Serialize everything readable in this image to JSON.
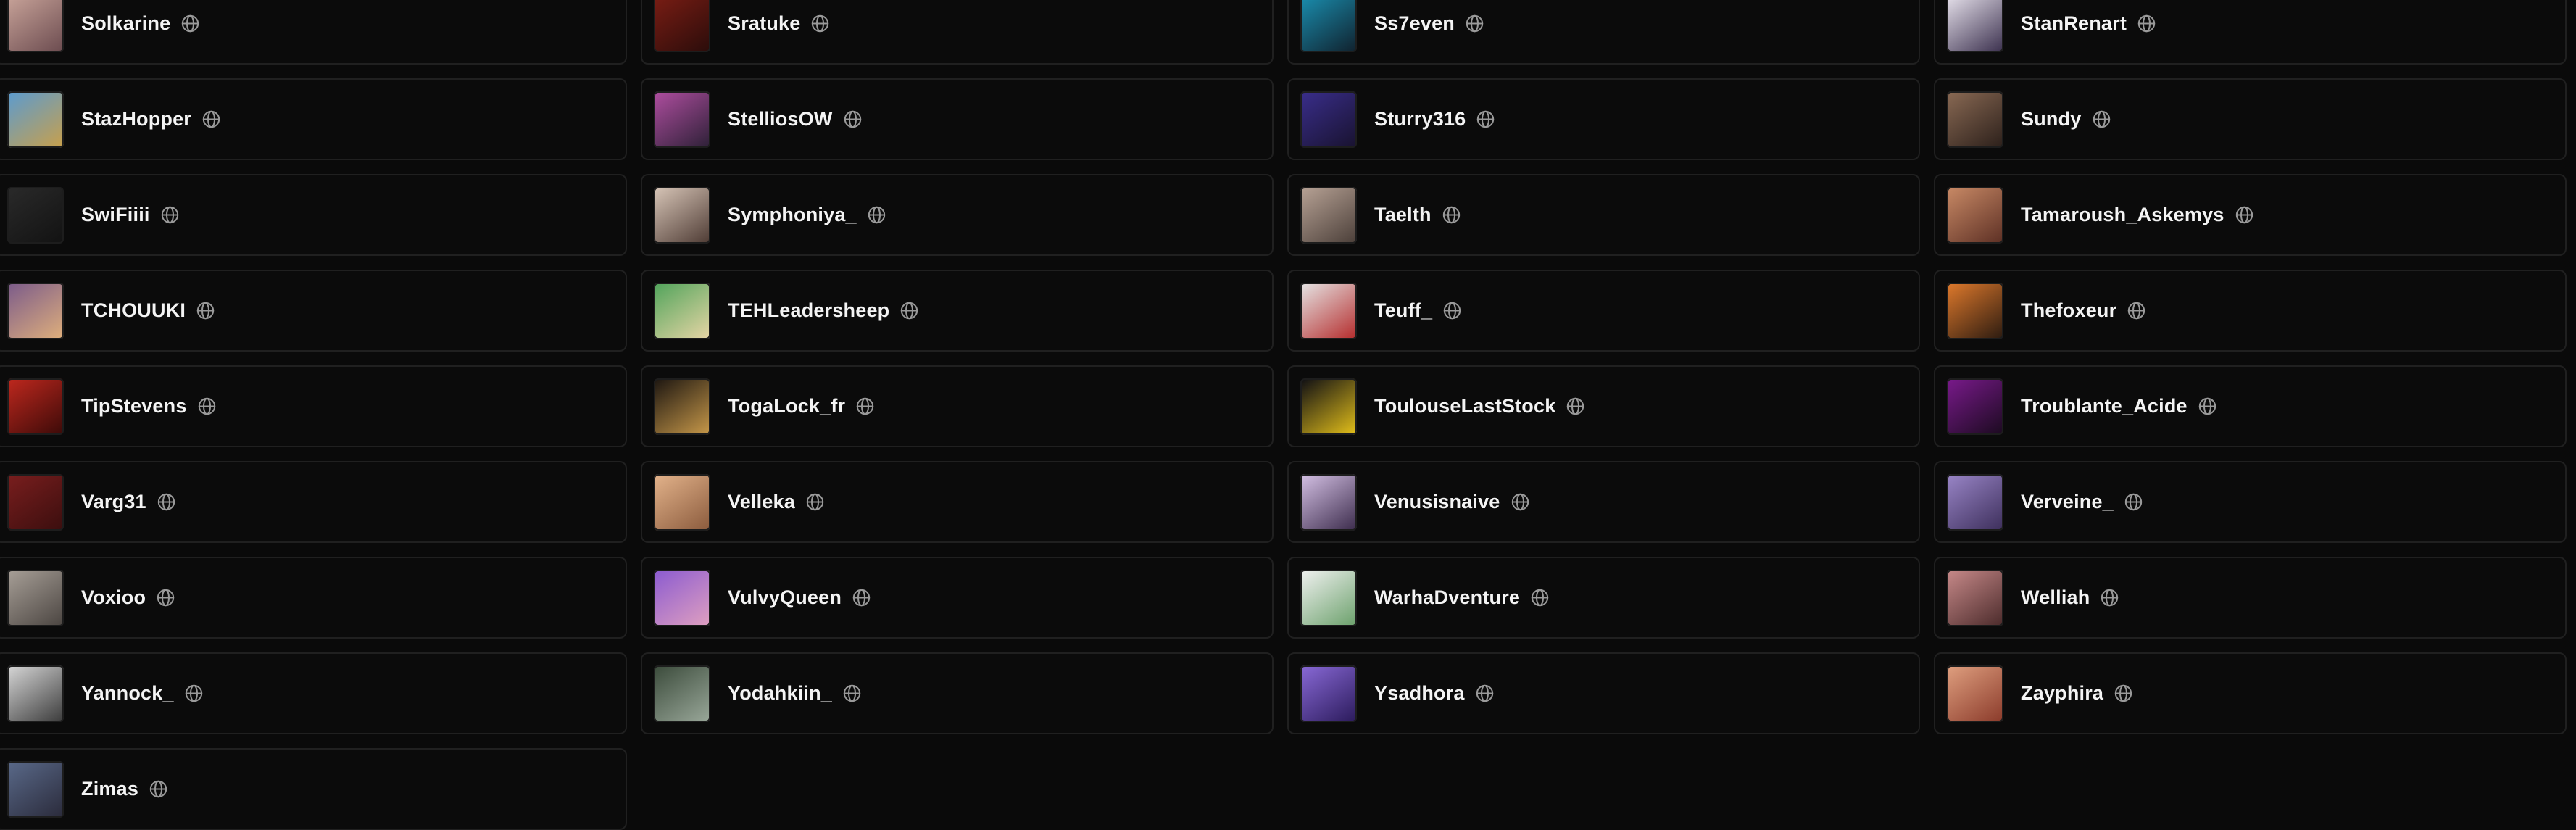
{
  "streamers": [
    {
      "name": "Solkarine",
      "avatar_colors": [
        "#c9a49a",
        "#6b4b4f"
      ]
    },
    {
      "name": "Sratuke",
      "avatar_colors": [
        "#7a1d14",
        "#2a0c0a"
      ]
    },
    {
      "name": "Ss7even",
      "avatar_colors": [
        "#1a8fb0",
        "#10202c"
      ]
    },
    {
      "name": "StanRenart",
      "avatar_colors": [
        "#e7e2ec",
        "#3a2f4d"
      ]
    },
    {
      "name": "StazHopper",
      "avatar_colors": [
        "#5a9bd1",
        "#c9a04a"
      ]
    },
    {
      "name": "StelliosOW",
      "avatar_colors": [
        "#b04ea0",
        "#2c2036"
      ]
    },
    {
      "name": "Sturry316",
      "avatar_colors": [
        "#3a2e8c",
        "#18122e"
      ]
    },
    {
      "name": "Sundy",
      "avatar_colors": [
        "#8a6a54",
        "#2b1f1a"
      ]
    },
    {
      "name": "SwiFiiii",
      "avatar_colors": [
        "#2a2a2a",
        "#121212"
      ]
    },
    {
      "name": "Symphoniya_",
      "avatar_colors": [
        "#d8c6b8",
        "#4d3a33"
      ]
    },
    {
      "name": "Taelth",
      "avatar_colors": [
        "#b8a396",
        "#4a3e38"
      ]
    },
    {
      "name": "Tamaroush_Askemys",
      "avatar_colors": [
        "#c98a66",
        "#5c2f24"
      ]
    },
    {
      "name": "TCHOUUKI",
      "avatar_colors": [
        "#7a5a8a",
        "#e0b07c"
      ]
    },
    {
      "name": "TEHLeadersheep",
      "avatar_colors": [
        "#4fa35a",
        "#e8d6a6"
      ]
    },
    {
      "name": "Teuff_",
      "avatar_colors": [
        "#e6e6e6",
        "#b42a2a"
      ]
    },
    {
      "name": "Thefoxeur",
      "avatar_colors": [
        "#e07a2c",
        "#2a1a10"
      ]
    },
    {
      "name": "TipStevens",
      "avatar_colors": [
        "#c0281e",
        "#3a0a08"
      ]
    },
    {
      "name": "TogaLock_fr",
      "avatar_colors": [
        "#1a1410",
        "#c99a4a"
      ]
    },
    {
      "name": "ToulouseLastStock",
      "avatar_colors": [
        "#0c0c14",
        "#e6c21a"
      ]
    },
    {
      "name": "Troublante_Acide",
      "avatar_colors": [
        "#7a1a8c",
        "#1a0a1e"
      ]
    },
    {
      "name": "Varg31",
      "avatar_colors": [
        "#7a1e1e",
        "#3a0e0e"
      ]
    },
    {
      "name": "Velleka",
      "avatar_colors": [
        "#e4b48c",
        "#8a5a3c"
      ]
    },
    {
      "name": "Venusisnaive",
      "avatar_colors": [
        "#d6c2e6",
        "#3a2a4a"
      ]
    },
    {
      "name": "Verveine_",
      "avatar_colors": [
        "#9a86c8",
        "#3c2e5a"
      ]
    },
    {
      "name": "Voxioo",
      "avatar_colors": [
        "#a8a098",
        "#4a4440"
      ]
    },
    {
      "name": "VulvyQueen",
      "avatar_colors": [
        "#8a5ad0",
        "#e0a0c0"
      ]
    },
    {
      "name": "WarhaDventure",
      "avatar_colors": [
        "#f2f2f2",
        "#6aa06a"
      ]
    },
    {
      "name": "Welliah",
      "avatar_colors": [
        "#c88a8a",
        "#4a2a2a"
      ]
    },
    {
      "name": "Yannock_",
      "avatar_colors": [
        "#d8d8d8",
        "#3a3a3a"
      ]
    },
    {
      "name": "Yodahkiin_",
      "avatar_colors": [
        "#3a4a3a",
        "#9aa89a"
      ]
    },
    {
      "name": "Ysadhora",
      "avatar_colors": [
        "#8a6ad8",
        "#2a1a5a"
      ]
    },
    {
      "name": "Zayphira",
      "avatar_colors": [
        "#e0a080",
        "#8a3a2a"
      ]
    },
    {
      "name": "Zimas",
      "avatar_colors": [
        "#5a6a8a",
        "#2a2a3a"
      ]
    }
  ],
  "icons": {
    "platform": "globe-icon"
  },
  "colors": {
    "background": "#0a0a0a",
    "card_background": "#0b0b0b",
    "card_border": "#202020",
    "text": "#f4f4f4",
    "icon": "#9a9a9a"
  }
}
